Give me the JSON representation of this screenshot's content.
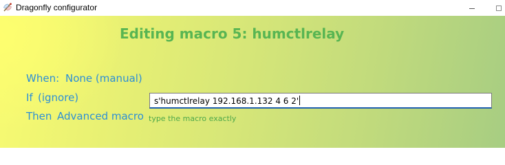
{
  "window": {
    "title": "Dragonfly configurator",
    "icon": "dragonfly-app-icon"
  },
  "heading": "Editing macro 5: humctlrelay",
  "when": {
    "label": "When:",
    "value": "None (manual)"
  },
  "if": {
    "label": "If",
    "value": "(ignore)"
  },
  "then": {
    "label": "Then",
    "value": "Advanced macro",
    "input_value": "s'humctlrelay 192.168.1.132 4 6 2'",
    "hint": "type the macro exactly"
  },
  "colors": {
    "heading": "#58b552",
    "label": "#2c8fd6",
    "hint": "#4ea84a",
    "input_focus_border": "#1f5fb0"
  }
}
